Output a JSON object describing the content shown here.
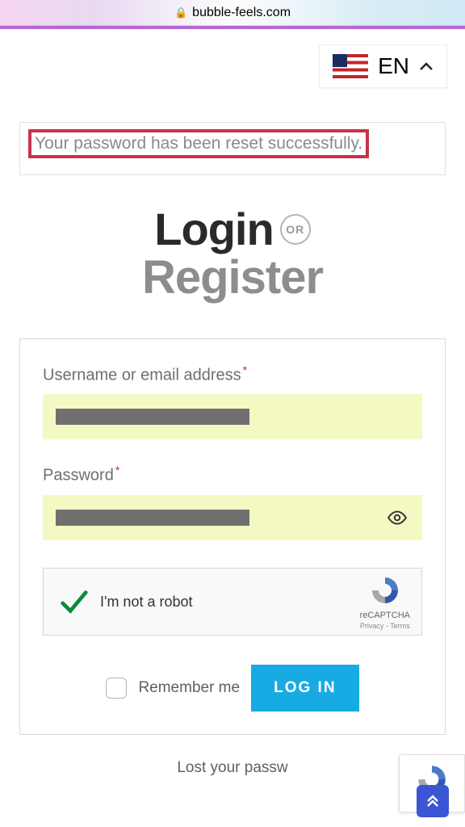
{
  "browser": {
    "url": "bubble-feels.com"
  },
  "lang": {
    "code": "EN"
  },
  "alert": {
    "message": "Your password has been reset successfully."
  },
  "heading": {
    "login": "Login",
    "or": "OR",
    "register": "Register"
  },
  "form": {
    "username_label": "Username or email address",
    "password_label": "Password",
    "captcha_label": "I'm not a robot",
    "captcha_brand": "reCAPTCHA",
    "captcha_links": "Privacy - Terms",
    "remember_label": "Remember me",
    "login_button": "LOG IN",
    "lost_password": "Lost your passw"
  },
  "widget": {
    "privacy": "Privacy"
  }
}
